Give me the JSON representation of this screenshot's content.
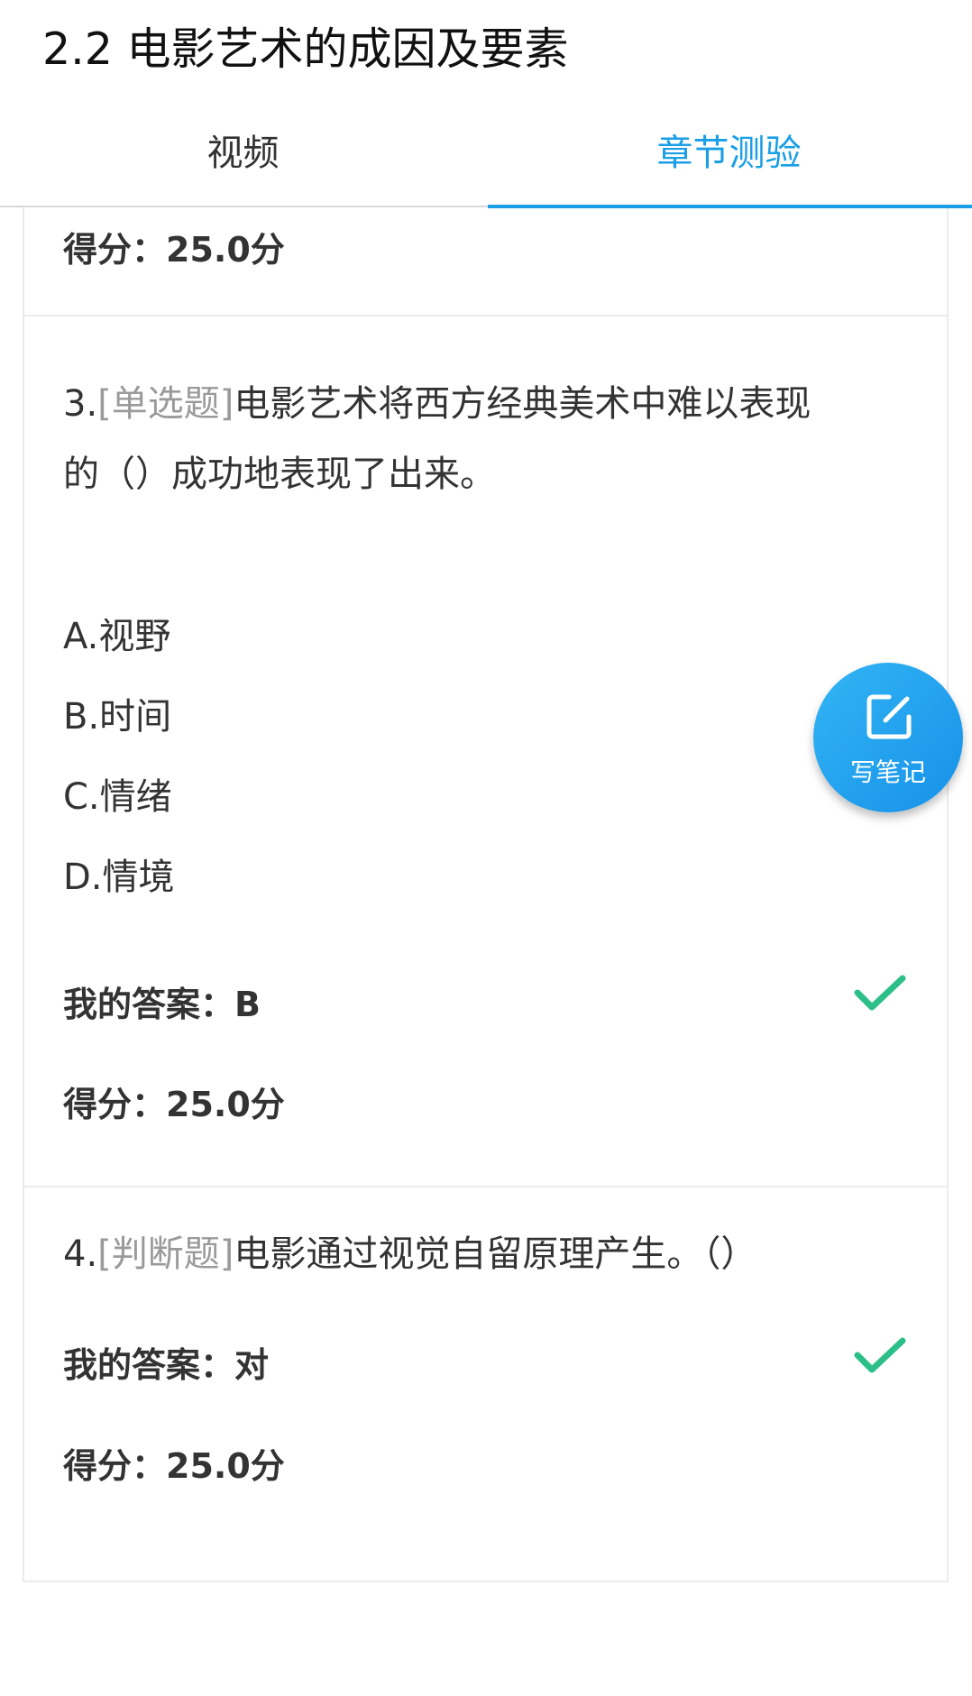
{
  "page_title": "2.2 电影艺术的成因及要素",
  "tabs": [
    {
      "label": "视频",
      "active": false
    },
    {
      "label": "章节测验",
      "active": true
    }
  ],
  "colors": {
    "accent": "#1a9ee6",
    "check_green": "#2dbf8a",
    "question_type_gray": "#9a9a9a"
  },
  "prev_question": {
    "score": "得分：25.0分"
  },
  "question3": {
    "number": "3.",
    "type": "[单选题]",
    "text_line1": "电影艺术将西方经典美术中难以表现",
    "text_line2": "的（）成功地表现了出来。",
    "options": [
      "A.视野",
      "B.时间",
      "C.情绪",
      "D.情境"
    ],
    "my_answer": "我的答案：B",
    "result_icon": "check-icon",
    "score": "得分：25.0分"
  },
  "question4": {
    "number": "4.",
    "type": "[判断题]",
    "text": "电影通过视觉自留原理产生。（）",
    "my_answer": "我的答案：对",
    "result_icon": "check-icon",
    "score": "得分：25.0分"
  },
  "note_button": {
    "label": "写笔记",
    "icon": "edit-note-icon"
  }
}
